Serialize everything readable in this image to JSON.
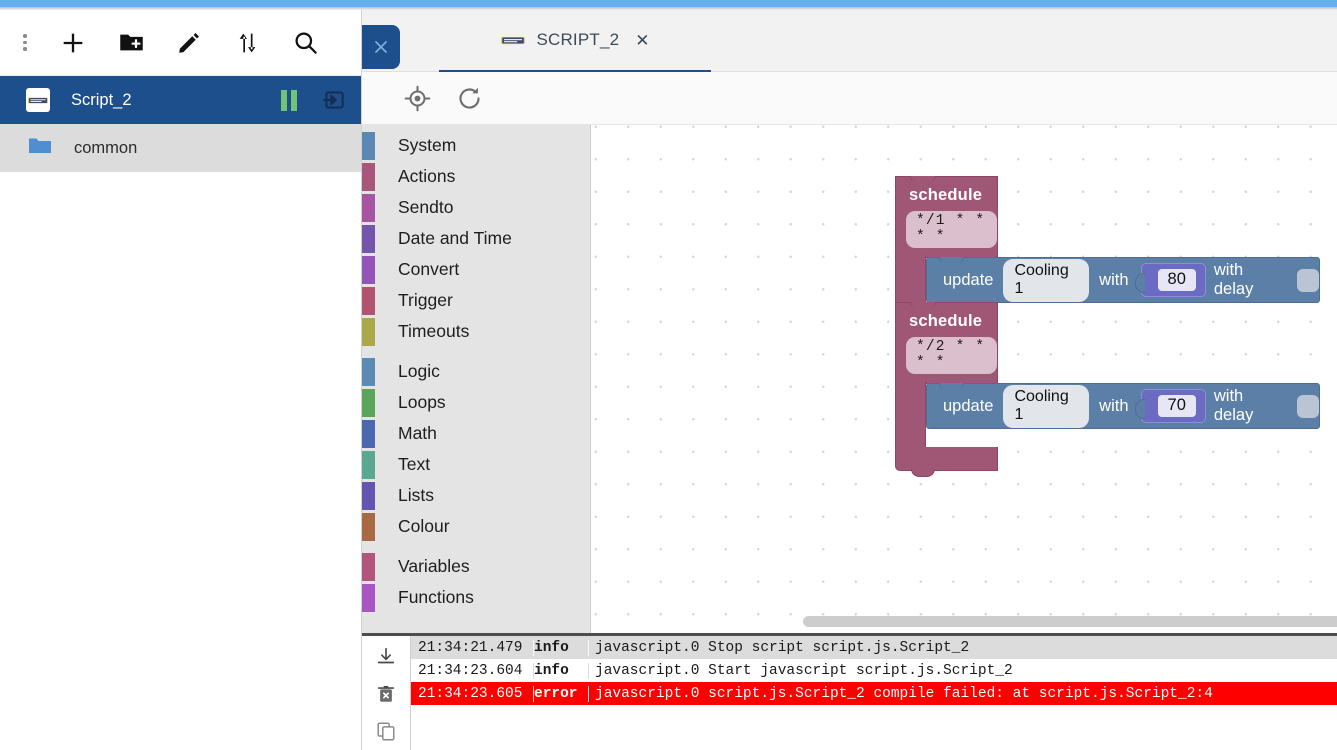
{
  "theme": {
    "accent_blue": "#1d4f8c",
    "topbar_blue": "#64b0f2",
    "error_red": "#fe0000",
    "schedule_block": "#a05675",
    "update_block": "#5b7fa6",
    "number_block": "#6b6bc4"
  },
  "sidebar": {
    "toolbar": [
      {
        "name": "more-options",
        "icon": "kebab-menu-icon",
        "label": ""
      },
      {
        "name": "add-script",
        "icon": "plus-icon",
        "label": ""
      },
      {
        "name": "add-folder",
        "icon": "folder-plus-icon",
        "label": ""
      },
      {
        "name": "rename",
        "icon": "pencil-icon",
        "label": ""
      },
      {
        "name": "expand-collapse",
        "icon": "sort-arrows-icon",
        "label": ""
      },
      {
        "name": "search",
        "icon": "search-icon",
        "label": ""
      }
    ],
    "items": [
      {
        "label": "Script_2",
        "type": "script",
        "selected": true,
        "actions": [
          "pause-icon",
          "export-icon"
        ]
      },
      {
        "label": "common",
        "type": "folder",
        "selected": false,
        "actions": []
      }
    ]
  },
  "tabstrip": {
    "close_panel_icon": "close-icon",
    "tabs": [
      {
        "label": "SCRIPT_2",
        "icon": "blockly-icon",
        "close_icon": "close-icon",
        "active": true
      }
    ]
  },
  "editor_toolbar": {
    "buttons": [
      {
        "name": "center-blocks",
        "icon": "crosshair-target-icon"
      },
      {
        "name": "reload-blocks",
        "icon": "refresh-icon"
      }
    ]
  },
  "toolbox": {
    "groups": [
      {
        "items": [
          {
            "label": "System",
            "color": "#5b88b2"
          },
          {
            "label": "Actions",
            "color": "#a9567b"
          },
          {
            "label": "Sendto",
            "color": "#a655a0"
          },
          {
            "label": "Date and Time",
            "color": "#7356ab"
          },
          {
            "label": "Convert",
            "color": "#9455b8"
          },
          {
            "label": "Trigger",
            "color": "#b2546e"
          },
          {
            "label": "Timeouts",
            "color": "#aaa84b"
          }
        ]
      },
      {
        "items": [
          {
            "label": "Logic",
            "color": "#5b8bb5"
          },
          {
            "label": "Loops",
            "color": "#5ba55b"
          },
          {
            "label": "Math",
            "color": "#4b68ae"
          },
          {
            "label": "Text",
            "color": "#5ba892"
          },
          {
            "label": "Lists",
            "color": "#6355b0"
          },
          {
            "label": "Colour",
            "color": "#a86a43"
          }
        ]
      },
      {
        "items": [
          {
            "label": "Variables",
            "color": "#b2547b"
          },
          {
            "label": "Functions",
            "color": "#a955c4"
          }
        ]
      }
    ]
  },
  "workspace": {
    "blocks": [
      {
        "type": "schedule",
        "title": "schedule",
        "cron": "*/1 * * * *",
        "statement": {
          "type": "update",
          "word1": "update",
          "object": "Cooling 1",
          "word2": "with",
          "value": "80",
          "word3": "with delay",
          "delay": ""
        }
      },
      {
        "type": "schedule",
        "title": "schedule",
        "cron": "*/2 * * * *",
        "statement": {
          "type": "update",
          "word1": "update",
          "object": "Cooling 1",
          "word2": "with",
          "value": "70",
          "word3": "with delay",
          "delay": ""
        }
      }
    ]
  },
  "console": {
    "tools": [
      {
        "name": "scroll-to-bottom",
        "icon": "download-arrow-icon"
      },
      {
        "name": "clear-log",
        "icon": "trash-icon"
      },
      {
        "name": "copy-log",
        "icon": "copy-icon"
      }
    ],
    "rows": [
      {
        "time": "21:34:21.479",
        "severity": "info",
        "message": "javascript.0 Stop script script.js.Script_2",
        "error": false
      },
      {
        "time": "21:34:23.604",
        "severity": "info",
        "message": "javascript.0 Start javascript script.js.Script_2",
        "error": false
      },
      {
        "time": "21:34:23.605",
        "severity": "error",
        "message": "javascript.0 script.js.Script_2 compile failed: at script.js.Script_2:4",
        "error": true
      }
    ]
  }
}
